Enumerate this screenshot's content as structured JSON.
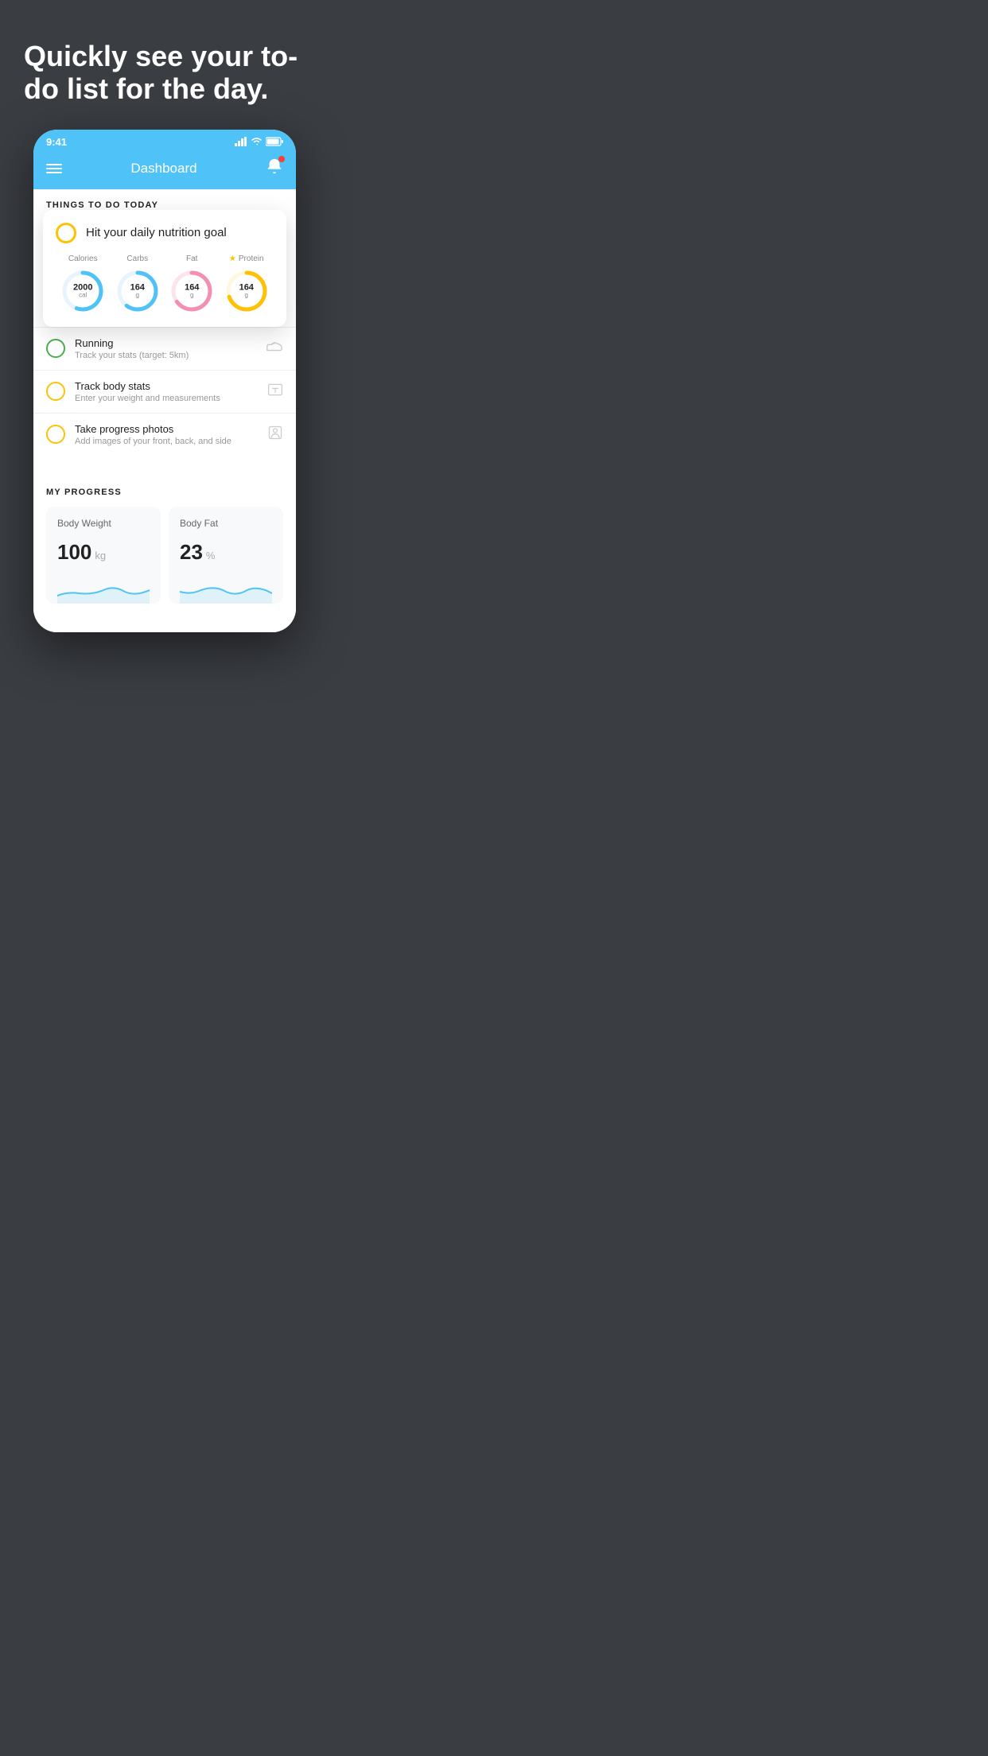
{
  "hero": {
    "title": "Quickly see your to-do list for the day."
  },
  "phone": {
    "status": {
      "time": "9:41"
    },
    "nav": {
      "title": "Dashboard"
    },
    "section_header": "THINGS TO DO TODAY",
    "nutrition_card": {
      "title": "Hit your daily nutrition goal",
      "items": [
        {
          "label": "Calories",
          "value": "2000",
          "unit": "cal",
          "color": "#4fc3f7",
          "percent": 55
        },
        {
          "label": "Carbs",
          "value": "164",
          "unit": "g",
          "color": "#4fc3f7",
          "percent": 60
        },
        {
          "label": "Fat",
          "value": "164",
          "unit": "g",
          "color": "#f48fb1",
          "percent": 65
        },
        {
          "label": "Protein",
          "value": "164",
          "unit": "g",
          "color": "#FFC107",
          "percent": 70,
          "star": true
        }
      ]
    },
    "todo_items": [
      {
        "id": "running",
        "title": "Running",
        "subtitle": "Track your stats (target: 5km)",
        "circle_color": "green",
        "icon": "shoe"
      },
      {
        "id": "body-stats",
        "title": "Track body stats",
        "subtitle": "Enter your weight and measurements",
        "circle_color": "yellow",
        "icon": "scale"
      },
      {
        "id": "progress-photos",
        "title": "Take progress photos",
        "subtitle": "Add images of your front, back, and side",
        "circle_color": "yellow",
        "icon": "person"
      }
    ],
    "progress": {
      "header": "MY PROGRESS",
      "cards": [
        {
          "title": "Body Weight",
          "value": "100",
          "unit": "kg"
        },
        {
          "title": "Body Fat",
          "value": "23",
          "unit": "%"
        }
      ]
    }
  }
}
